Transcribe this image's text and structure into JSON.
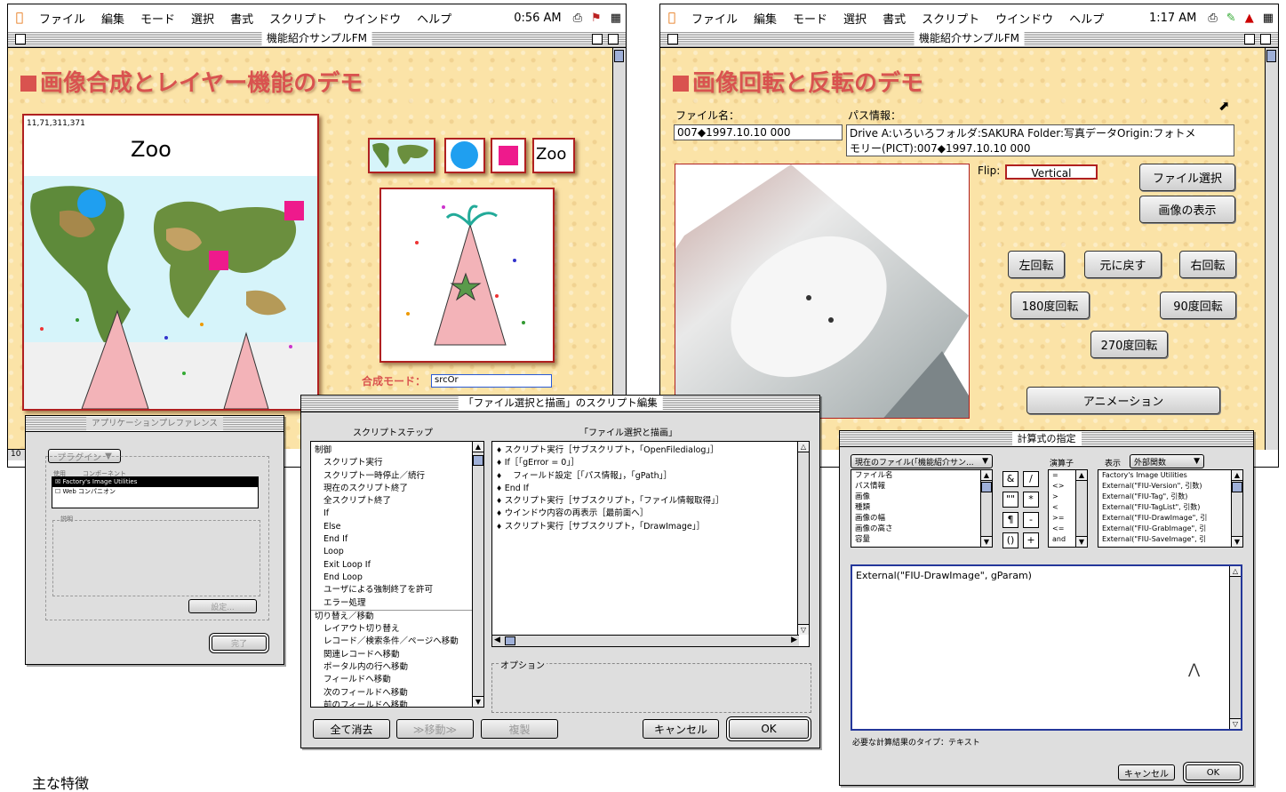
{
  "menubar": {
    "items": [
      "ファイル",
      "編集",
      "モード",
      "選択",
      "書式",
      "スクリプト",
      "ウインドウ",
      "ヘルプ"
    ]
  },
  "window1": {
    "clock": "0:56 AM",
    "title": "機能紹介サンプルFM",
    "demo_title": "画像合成とレイヤー機能のデモ",
    "coords": "11,71,311,371",
    "zoo_label": "Zoo",
    "layer_zoo": "Zoo",
    "mode_label": "合成モード：",
    "mode_value": "srcOr",
    "zoom_value": "10"
  },
  "window2": {
    "clock": "1:17 AM",
    "title": "機能紹介サンプルFM",
    "demo_title": "画像回転と反転のデモ",
    "file_label": "ファイル名：",
    "file_value": "007◆1997.10.10 000",
    "path_label": "パス情報：",
    "path_line1": "Drive A:いろいろフォルダ:SAKURA Folder:写真データOrigin:フォトメ",
    "path_line2": "モリー(PICT):007◆1997.10.10 000",
    "flip_label": "Flip:",
    "flip_value": "Vertical",
    "btn_select": "ファイル選択",
    "btn_show": "画像の表示",
    "btn_left": "左回転",
    "btn_reset": "元に戻す",
    "btn_right": "右回転",
    "btn_180": "180度回転",
    "btn_90": "90度回転",
    "btn_270": "270度回転",
    "btn_anim": "アニメーション"
  },
  "prefs": {
    "title": "アプリケーションプレファレンス",
    "popup": "プラグイン",
    "col_use": "使用",
    "col_name": "コンポーネント",
    "item1": "Factory's Image Utilities",
    "item2": "Web コンパニオン",
    "section": "説明",
    "btn_settings": "設定...",
    "btn_done": "完了"
  },
  "script": {
    "title": "「ファイル選択と描画」のスクリプト編集",
    "steps_header": "スクリプトステップ",
    "script_header": "「ファイル選択と描画」",
    "steps": [
      {
        "t": "制御",
        "h": true
      },
      {
        "t": "スクリプト実行",
        "h": false
      },
      {
        "t": "スクリプト一時停止／続行",
        "h": false
      },
      {
        "t": "現在のスクリプト終了",
        "h": false
      },
      {
        "t": "全スクリプト終了",
        "h": false
      },
      {
        "t": "If",
        "h": false
      },
      {
        "t": "Else",
        "h": false
      },
      {
        "t": "End If",
        "h": false
      },
      {
        "t": "Loop",
        "h": false
      },
      {
        "t": "Exit Loop If",
        "h": false
      },
      {
        "t": "End Loop",
        "h": false
      },
      {
        "t": "ユーザによる強制終了を許可",
        "h": false
      },
      {
        "t": "エラー処理",
        "h": false
      },
      {
        "t": "切り替え／移動",
        "h": true
      },
      {
        "t": "レイアウト切り替え",
        "h": false
      },
      {
        "t": "レコード／検索条件／ページへ移動",
        "h": false
      },
      {
        "t": "関連レコードへ移動",
        "h": false
      },
      {
        "t": "ポータル内の行へ移動",
        "h": false
      },
      {
        "t": "フィールドへ移動",
        "h": false
      },
      {
        "t": "次のフィールドへ移動",
        "h": false
      },
      {
        "t": "前のフィールドへ移動",
        "h": false
      }
    ],
    "lines": [
      "スクリプト実行［サブスクリプト，「OpenFiledialog」］",
      "If［「gError = 0」］",
      "　フィールド設定［「パス情報」，「gPath」］",
      "End If",
      "スクリプト実行［サブスクリプト，「ファイル情報取得」］",
      "ウインドウ内容の再表示［最前面へ］",
      "スクリプト実行［サブスクリプト，「DrawImage」］"
    ],
    "options_label": "オプション",
    "btn_clear": "全て消去",
    "btn_move": "≫移動≫",
    "btn_dup": "複製",
    "btn_cancel": "キャンセル",
    "btn_ok": "OK"
  },
  "calc": {
    "title": "計算式の指定",
    "file_popup": "現在のファイル(「機能紹介サン...",
    "fields": [
      "ファイル名",
      "パス情報",
      "画像",
      "種類",
      "画像の幅",
      "画像の高さ",
      "容量"
    ],
    "ops": [
      "&",
      "/",
      "\"\"",
      "*",
      "¶",
      "-",
      "()",
      "+"
    ],
    "operators_label": "演算子",
    "op_list": [
      "=",
      "<>",
      ">",
      "<",
      ">=",
      "<=",
      "and"
    ],
    "display_label": "表示",
    "func_popup": "外部関数",
    "funcs": [
      "Factory's Image Utilities",
      "External(\"FIU-Version\", 引数)",
      "External(\"FIU-Tag\", 引数)",
      "External(\"FIU-TagList\", 引数)",
      "External(\"FIU-DrawImage\", 引",
      "External(\"FIU-GrabImage\", 引",
      "External(\"FIU-SaveImage\", 引"
    ],
    "formula": "External(\"FIU-DrawImage\", gParam)",
    "result_type": "必要な計算結果のタイプ：テキスト",
    "btn_cancel": "キャンセル",
    "btn_ok": "OK"
  },
  "footer_text": "主な特徴"
}
